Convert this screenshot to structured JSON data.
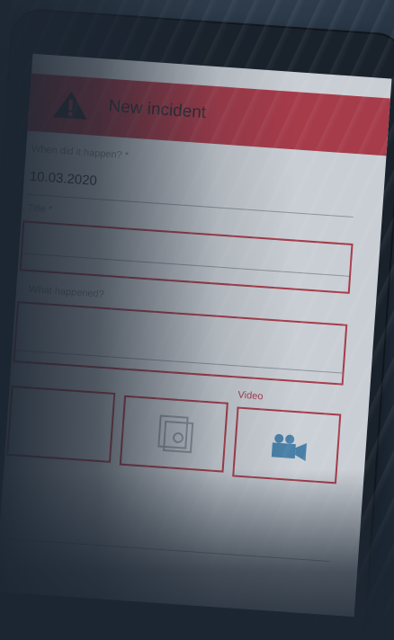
{
  "header": {
    "title": "New incident",
    "color": "#a63b4a",
    "icon": "warning-icon"
  },
  "form": {
    "when_label": "When did it happen? *",
    "when_value": "10.03.2020",
    "field2_label": "Title *",
    "field3_label": "What happened?",
    "media": {
      "video_label": "Video",
      "photo_icon": "photo-icon",
      "video_icon": "video-camera-icon"
    }
  }
}
